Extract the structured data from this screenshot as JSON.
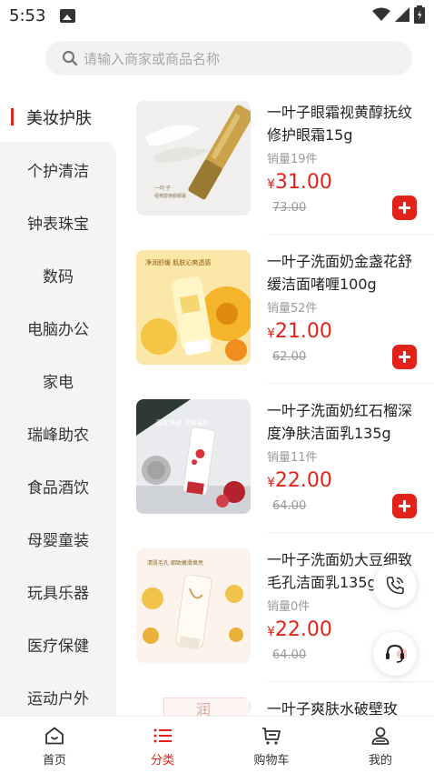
{
  "status_bar": {
    "time": "5:53"
  },
  "search": {
    "placeholder": "请输入商家或商品名称"
  },
  "categories": [
    {
      "label": "美妆护肤",
      "active": true
    },
    {
      "label": "个护清洁"
    },
    {
      "label": "钟表珠宝"
    },
    {
      "label": "数码"
    },
    {
      "label": "电脑办公"
    },
    {
      "label": "家电"
    },
    {
      "label": "瑞峰助农"
    },
    {
      "label": "食品酒饮"
    },
    {
      "label": "母婴童装"
    },
    {
      "label": "玩具乐器"
    },
    {
      "label": "医疗保健"
    },
    {
      "label": "运动户外"
    }
  ],
  "products": [
    {
      "name": "一叶子眼霜视黄醇抚纹修护眼霜15g",
      "sales": "销量19件",
      "price_symbol": "¥",
      "price": "31.00",
      "original_price": "73.00",
      "thumb_text": "一叶子\n视黄醇焕颜眼霜"
    },
    {
      "name": "一叶子洗面奶金盏花舒缓洁面啫喱100g",
      "sales": "销量52件",
      "price_symbol": "¥",
      "price": "21.00",
      "original_price": "62.00",
      "thumb_text": "净润舒缓 肌肤沁爽透感"
    },
    {
      "name": "一叶子洗面奶红石榴深度净肤洁面乳135g",
      "sales": "销量11件",
      "price_symbol": "¥",
      "price": "22.00",
      "original_price": "64.00",
      "thumb_text": "深度净透 清爽洁肤"
    },
    {
      "name": "一叶子洗面奶大豆细致毛孔洁面乳135g",
      "sales": "销量0件",
      "price_symbol": "¥",
      "price": "22.00",
      "original_price": "64.00",
      "thumb_text": "清肌毛孔 细致嫩滑焕亮"
    },
    {
      "name": "一叶子爽肤水破壁玫",
      "thumb_text": "润"
    }
  ],
  "tabs": [
    {
      "label": "首页",
      "icon": "home-icon"
    },
    {
      "label": "分类",
      "icon": "list-icon",
      "active": true
    },
    {
      "label": "购物车",
      "icon": "cart-icon"
    },
    {
      "label": "我的",
      "icon": "user-icon"
    }
  ],
  "colors": {
    "accent": "#e2231a",
    "sidebar_bg": "#f4f4f4",
    "muted": "#999999"
  }
}
